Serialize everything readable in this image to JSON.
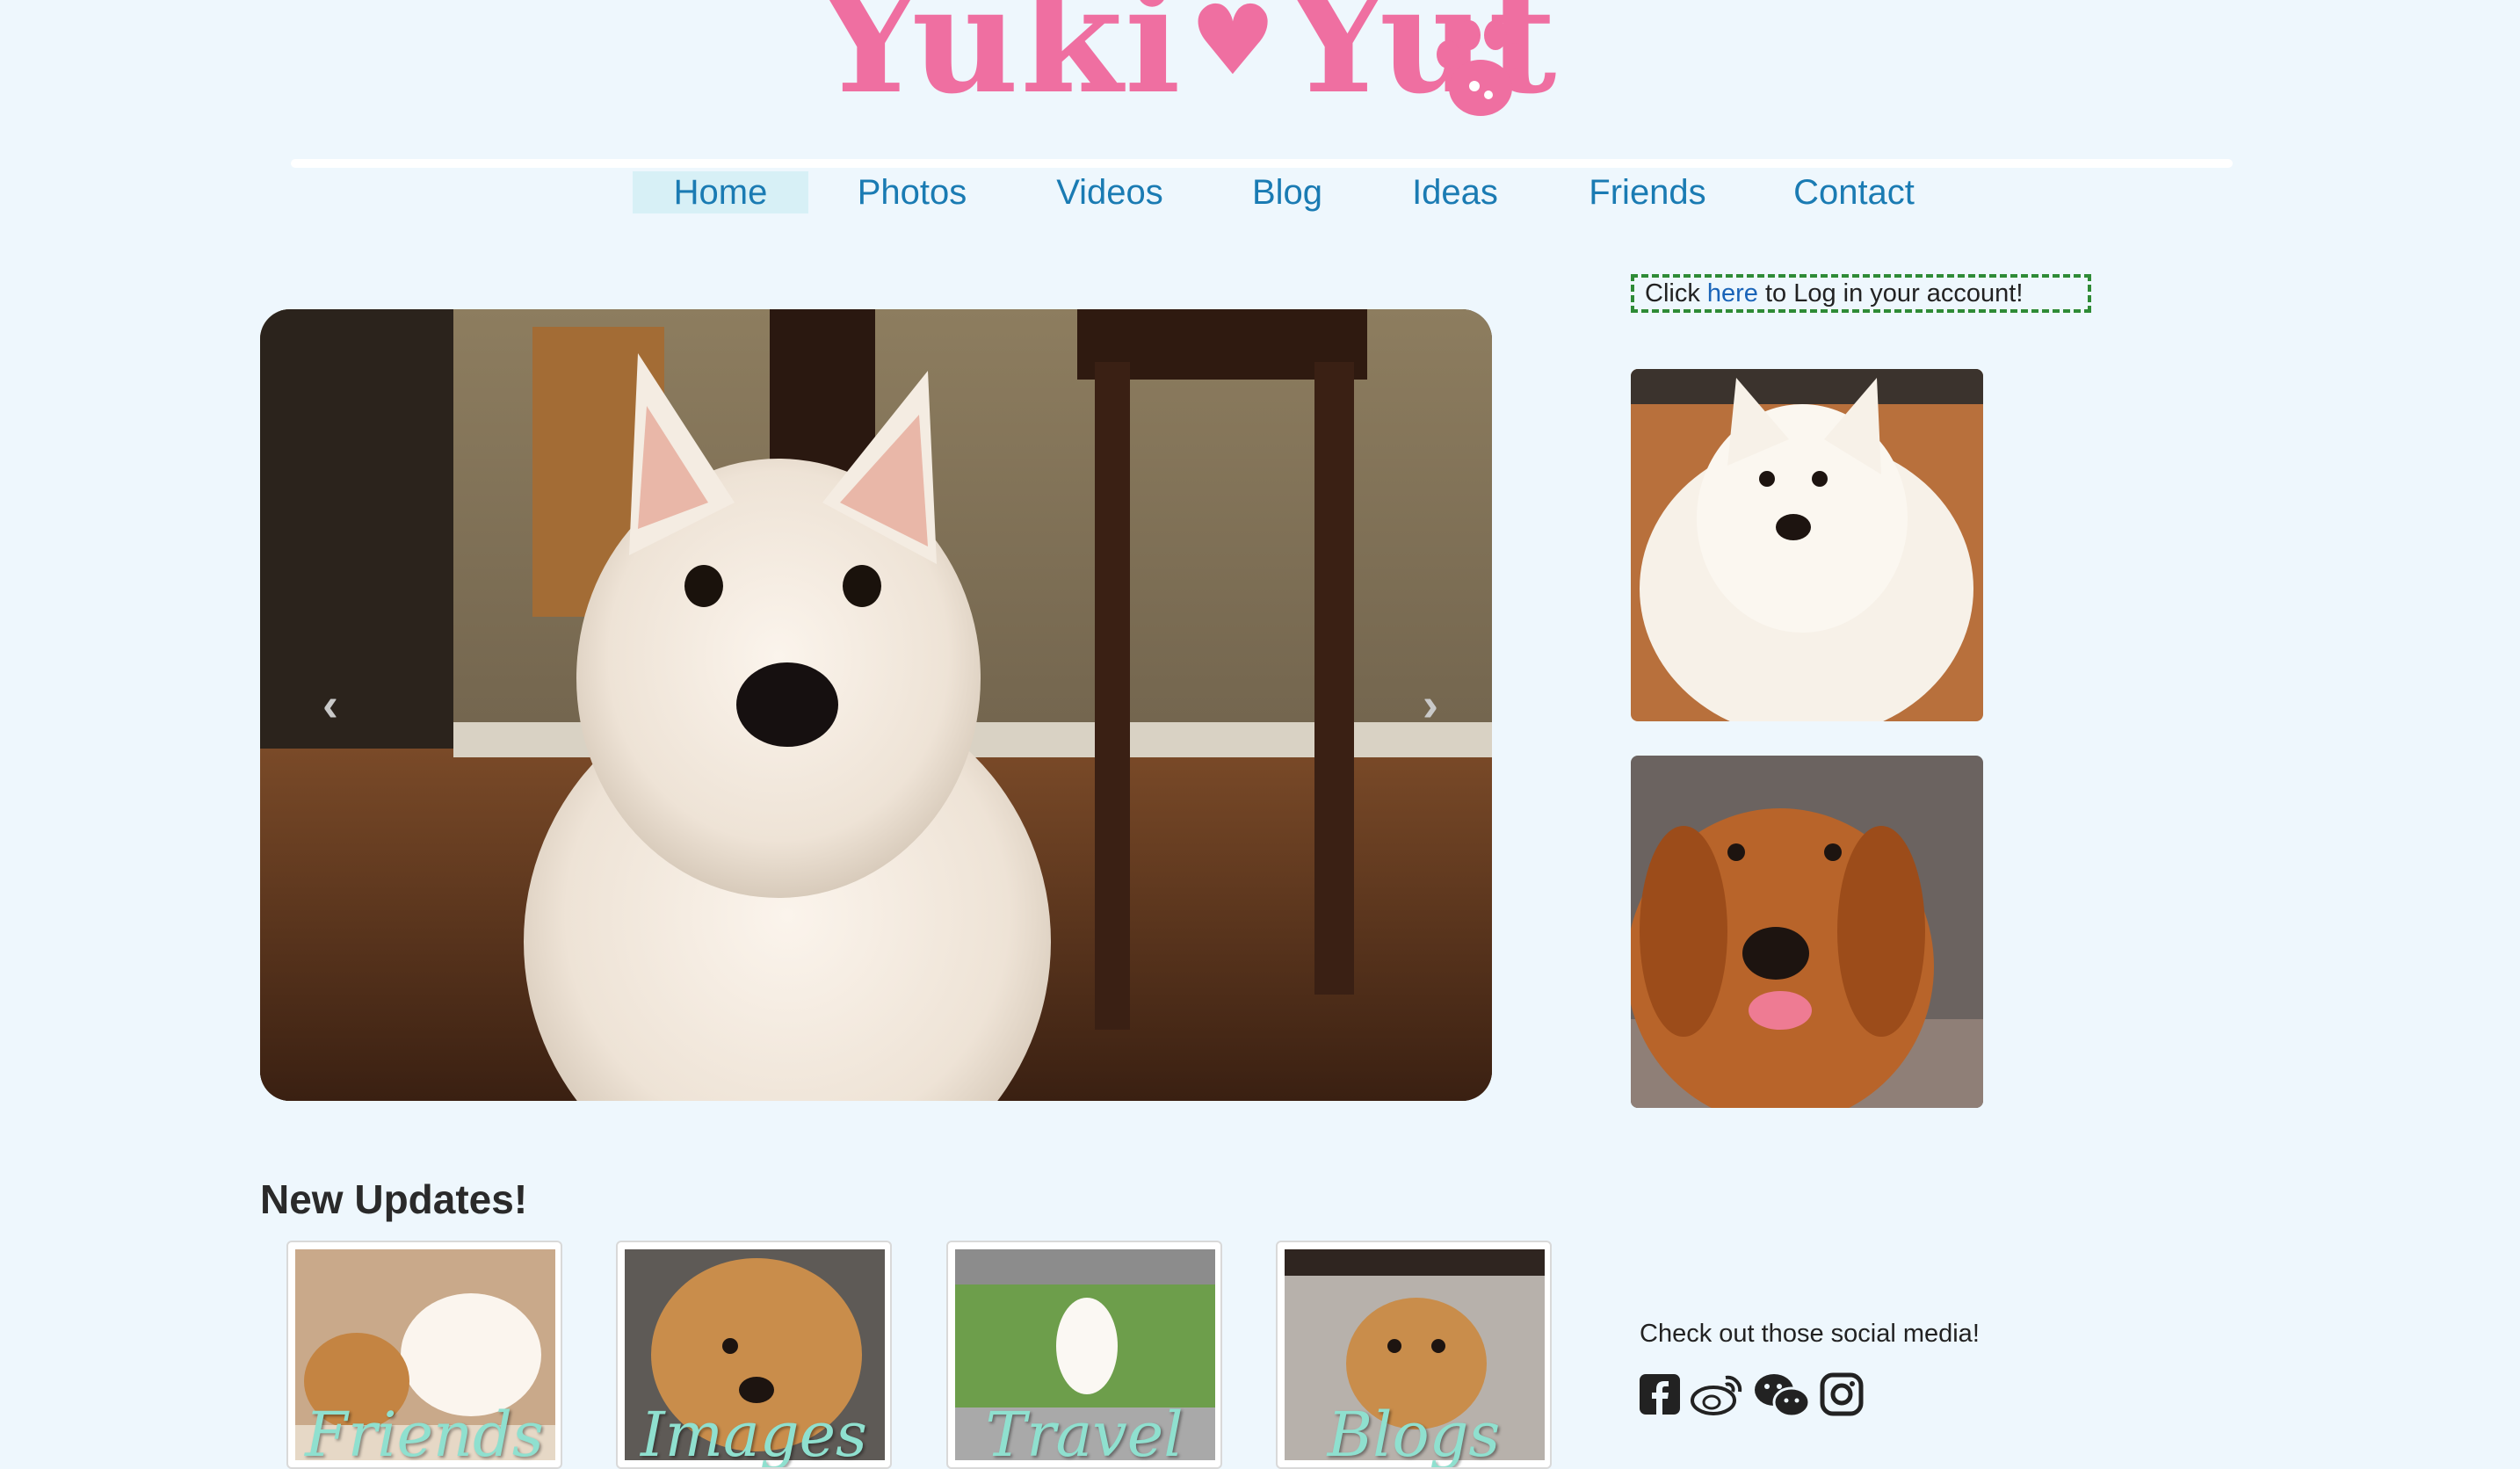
{
  "logo": {
    "text_left": "Yuki",
    "heart": "♥",
    "text_right": "Yut",
    "accent_color": "#ef6fa1"
  },
  "nav": {
    "items": [
      {
        "label": "Home",
        "active": true
      },
      {
        "label": "Photos"
      },
      {
        "label": "Videos"
      },
      {
        "label": "Blog"
      },
      {
        "label": "Ideas"
      },
      {
        "label": "Friends"
      },
      {
        "label": "Contact"
      }
    ],
    "color": "#1a7bb3"
  },
  "login": {
    "prefix": "Click ",
    "link": "here",
    "suffix": " to Log in your account!"
  },
  "carousel": {
    "prev_icon": "chevron-left-icon",
    "next_icon": "chevron-right-icon",
    "prev_glyph": "‹",
    "next_glyph": "›"
  },
  "updates": {
    "title": "New Updates!",
    "cards": [
      {
        "caption": "Friends"
      },
      {
        "caption": "Images"
      },
      {
        "caption": "Travel"
      },
      {
        "caption": "Blogs"
      }
    ]
  },
  "social": {
    "text": "Check out those social media!",
    "icons": [
      "facebook-icon",
      "weibo-icon",
      "wechat-icon",
      "instagram-icon"
    ]
  },
  "colors": {
    "background": "#eef7fd",
    "login_border": "#2e8b36",
    "link": "#1a64b8"
  }
}
